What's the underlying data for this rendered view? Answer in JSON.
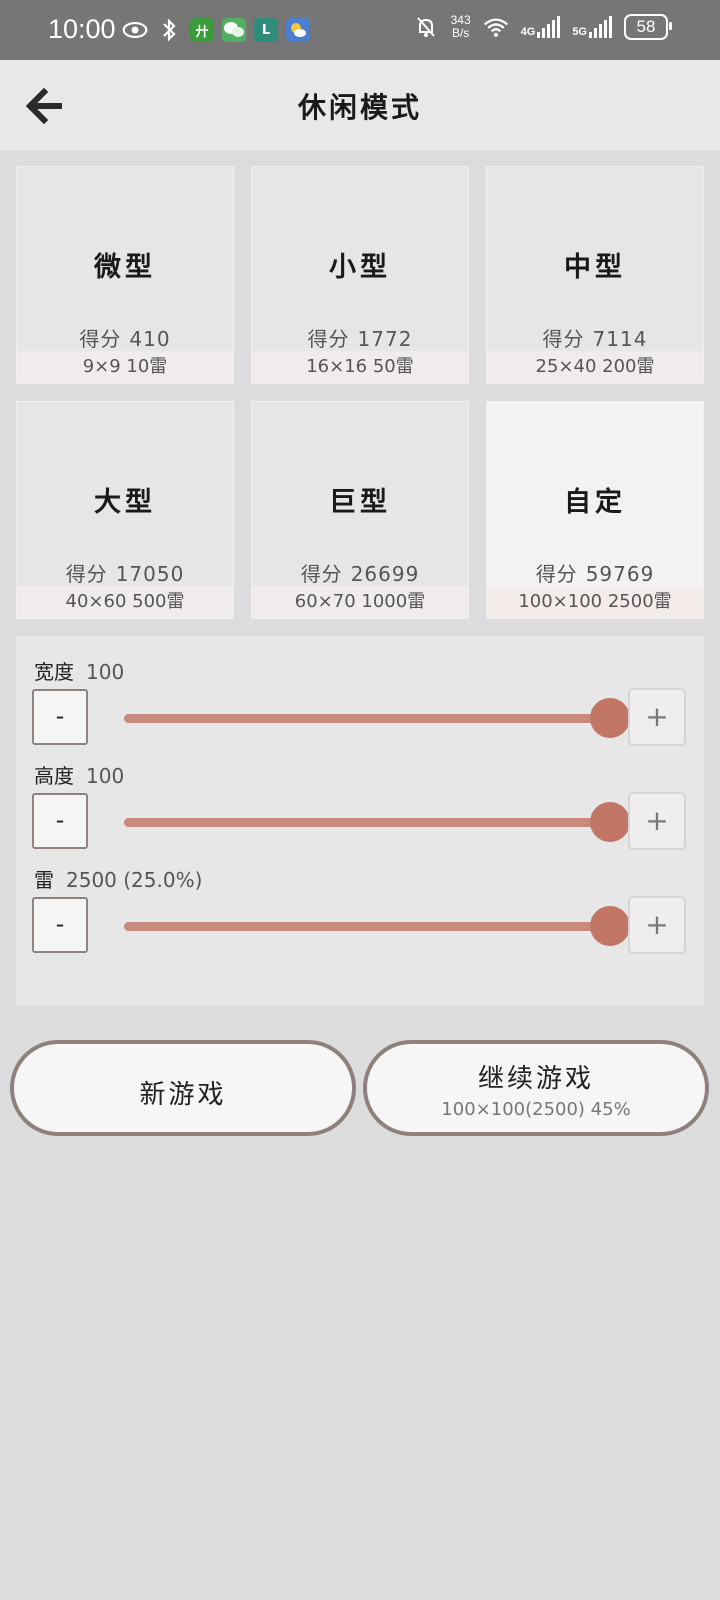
{
  "status_bar": {
    "time": "10:00",
    "speed_value": "343",
    "speed_unit": "B/s",
    "net1": "4G",
    "net2": "5G",
    "battery": "58"
  },
  "header": {
    "title": "休闲模式",
    "back_icon": "arrow-left-icon"
  },
  "modes": [
    {
      "name": "微型",
      "score_label": "得分",
      "score": "410",
      "info": "9×9  10雷",
      "selected": false
    },
    {
      "name": "小型",
      "score_label": "得分",
      "score": "1772",
      "info": "16×16  50雷",
      "selected": false
    },
    {
      "name": "中型",
      "score_label": "得分",
      "score": "7114",
      "info": "25×40  200雷",
      "selected": false
    },
    {
      "name": "大型",
      "score_label": "得分",
      "score": "17050",
      "info": "40×60  500雷",
      "selected": false
    },
    {
      "name": "巨型",
      "score_label": "得分",
      "score": "26699",
      "info": "60×70  1000雷",
      "selected": false
    },
    {
      "name": "自定",
      "score_label": "得分",
      "score": "59769",
      "info": "100×100  2500雷",
      "selected": true
    }
  ],
  "custom": {
    "width": {
      "label": "宽度",
      "value": "100",
      "level": 1.0
    },
    "height": {
      "label": "高度",
      "value": "100",
      "level": 1.0
    },
    "mines": {
      "label": "雷",
      "value": "2500 (25.0%)",
      "level": 1.0
    },
    "minus_label": "-",
    "plus_label": "+"
  },
  "actions": {
    "new_game": "新游戏",
    "continue_game": "继续游戏",
    "continue_info": "100×100(2500) 45%"
  },
  "colors": {
    "accent": "#c07565",
    "track": "#d3a094",
    "button_border": "#8e807c"
  }
}
